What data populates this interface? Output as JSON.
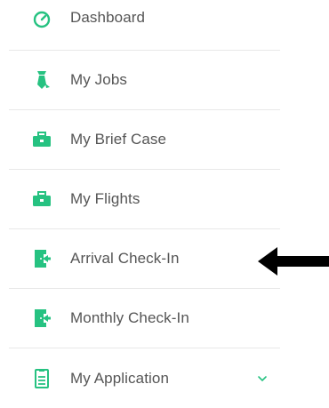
{
  "sidebar": {
    "items": [
      {
        "label": "Dashboard",
        "icon": "dashboard-gauge-icon"
      },
      {
        "label": "My Jobs",
        "icon": "tie-icon"
      },
      {
        "label": "My Brief Case",
        "icon": "briefcase-icon"
      },
      {
        "label": "My Flights",
        "icon": "briefcase-icon"
      },
      {
        "label": "Arrival Check-In",
        "icon": "check-in-door-icon"
      },
      {
        "label": "Monthly Check-In",
        "icon": "check-in-door-icon"
      },
      {
        "label": "My Application",
        "icon": "document-icon"
      }
    ]
  },
  "colors": {
    "accent": "#26c281",
    "text": "#555555",
    "divider": "#e8e8e8",
    "annotation_arrow": "#000000"
  },
  "annotation": {
    "arrow_icon": "left-arrow-icon",
    "points_to": "Arrival Check-In"
  }
}
